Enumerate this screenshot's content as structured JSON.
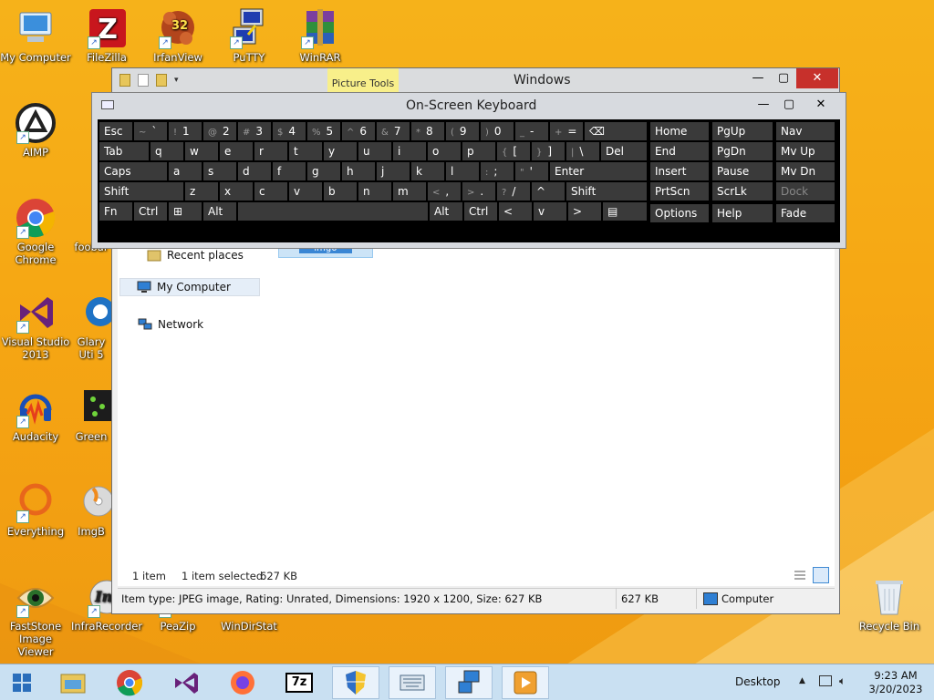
{
  "desktop": {
    "icons": [
      {
        "label": "My Computer"
      },
      {
        "label": "FileZilla"
      },
      {
        "label": "IrfanView"
      },
      {
        "label": "PuTTY"
      },
      {
        "label": "WinRAR"
      },
      {
        "label": "AIMP"
      },
      {
        "label": "Google Chrome"
      },
      {
        "label": "foobar"
      },
      {
        "label": "Visual Studio 2013"
      },
      {
        "label": "Glary Uti 5"
      },
      {
        "label": "Audacity"
      },
      {
        "label": "Green"
      },
      {
        "label": "Everything"
      },
      {
        "label": "ImgB"
      },
      {
        "label": "FastStone Image Viewer"
      },
      {
        "label": "InfraRecorder"
      },
      {
        "label": "PeaZip"
      },
      {
        "label": "WinDirStat"
      },
      {
        "label": "Recycle Bin"
      }
    ],
    "irfanview_badge": "32"
  },
  "explorer": {
    "title": "Windows",
    "picture_tools": "Picture Tools",
    "buttons": {
      "minimize": "—",
      "maximize": "▢",
      "close": "✕"
    },
    "nav": {
      "recent_places": "Recent places",
      "my_computer": "My Computer",
      "network": "Network"
    },
    "file_label": "img0",
    "status": {
      "items": "1 item",
      "selected": "1 item selected",
      "selected_size": "627 KB"
    },
    "info": {
      "details": "Item type: JPEG image, Rating: Unrated, Dimensions: 1920 x 1200, Size: 627 KB",
      "size": "627 KB",
      "location": "Computer"
    }
  },
  "osk": {
    "title": "On-Screen Keyboard",
    "buttons": {
      "minimize": "—",
      "maximize": "▢",
      "close": "✕"
    },
    "row1": [
      {
        "main": "Esc",
        "alt": ""
      },
      {
        "main": "`",
        "alt": "~"
      },
      {
        "main": "1",
        "alt": "!"
      },
      {
        "main": "2",
        "alt": "@"
      },
      {
        "main": "3",
        "alt": "#"
      },
      {
        "main": "4",
        "alt": "$"
      },
      {
        "main": "5",
        "alt": "%"
      },
      {
        "main": "6",
        "alt": "^"
      },
      {
        "main": "7",
        "alt": "&"
      },
      {
        "main": "8",
        "alt": "*"
      },
      {
        "main": "9",
        "alt": "("
      },
      {
        "main": "0",
        "alt": ")"
      },
      {
        "main": "-",
        "alt": "_"
      },
      {
        "main": "=",
        "alt": "+"
      },
      {
        "main": "⌫",
        "alt": ""
      }
    ],
    "row2": [
      {
        "main": "Tab",
        "alt": ""
      },
      {
        "main": "q",
        "alt": ""
      },
      {
        "main": "w",
        "alt": ""
      },
      {
        "main": "e",
        "alt": ""
      },
      {
        "main": "r",
        "alt": ""
      },
      {
        "main": "t",
        "alt": ""
      },
      {
        "main": "y",
        "alt": ""
      },
      {
        "main": "u",
        "alt": ""
      },
      {
        "main": "i",
        "alt": ""
      },
      {
        "main": "o",
        "alt": ""
      },
      {
        "main": "p",
        "alt": ""
      },
      {
        "main": "[",
        "alt": "{"
      },
      {
        "main": "]",
        "alt": "}"
      },
      {
        "main": "\\",
        "alt": "|"
      },
      {
        "main": "Del",
        "alt": ""
      }
    ],
    "row3": [
      {
        "main": "Caps",
        "alt": ""
      },
      {
        "main": "a",
        "alt": ""
      },
      {
        "main": "s",
        "alt": ""
      },
      {
        "main": "d",
        "alt": ""
      },
      {
        "main": "f",
        "alt": ""
      },
      {
        "main": "g",
        "alt": ""
      },
      {
        "main": "h",
        "alt": ""
      },
      {
        "main": "j",
        "alt": ""
      },
      {
        "main": "k",
        "alt": ""
      },
      {
        "main": "l",
        "alt": ""
      },
      {
        "main": ";",
        "alt": ":"
      },
      {
        "main": "'",
        "alt": "\""
      },
      {
        "main": "Enter",
        "alt": ""
      }
    ],
    "row4": [
      {
        "main": "Shift",
        "alt": ""
      },
      {
        "main": "z",
        "alt": ""
      },
      {
        "main": "x",
        "alt": ""
      },
      {
        "main": "c",
        "alt": ""
      },
      {
        "main": "v",
        "alt": ""
      },
      {
        "main": "b",
        "alt": ""
      },
      {
        "main": "n",
        "alt": ""
      },
      {
        "main": "m",
        "alt": ""
      },
      {
        "main": ",",
        "alt": "<"
      },
      {
        "main": ".",
        "alt": ">"
      },
      {
        "main": "/",
        "alt": "?"
      },
      {
        "main": "^",
        "alt": ""
      },
      {
        "main": "Shift",
        "alt": ""
      }
    ],
    "row5": [
      {
        "main": "Fn",
        "alt": ""
      },
      {
        "main": "Ctrl",
        "alt": ""
      },
      {
        "main": "⊞",
        "alt": ""
      },
      {
        "main": "Alt",
        "alt": ""
      },
      {
        "main": "",
        "alt": ""
      },
      {
        "main": "Alt",
        "alt": ""
      },
      {
        "main": "Ctrl",
        "alt": ""
      },
      {
        "main": "<",
        "alt": ""
      },
      {
        "main": "v",
        "alt": ""
      },
      {
        "main": ">",
        "alt": ""
      },
      {
        "main": "▤",
        "alt": ""
      }
    ],
    "nav_cluster": [
      [
        "Home",
        "PgUp",
        "Nav"
      ],
      [
        "End",
        "PgDn",
        "Mv Up"
      ],
      [
        "Insert",
        "Pause",
        "Mv Dn"
      ],
      [
        "PrtScn",
        "ScrLk",
        "Dock"
      ],
      [
        "Options",
        "Help",
        "Fade"
      ]
    ]
  },
  "taskbar": {
    "desktop_label": "Desktop",
    "time": "9:23 AM",
    "date": "3/20/2023"
  }
}
